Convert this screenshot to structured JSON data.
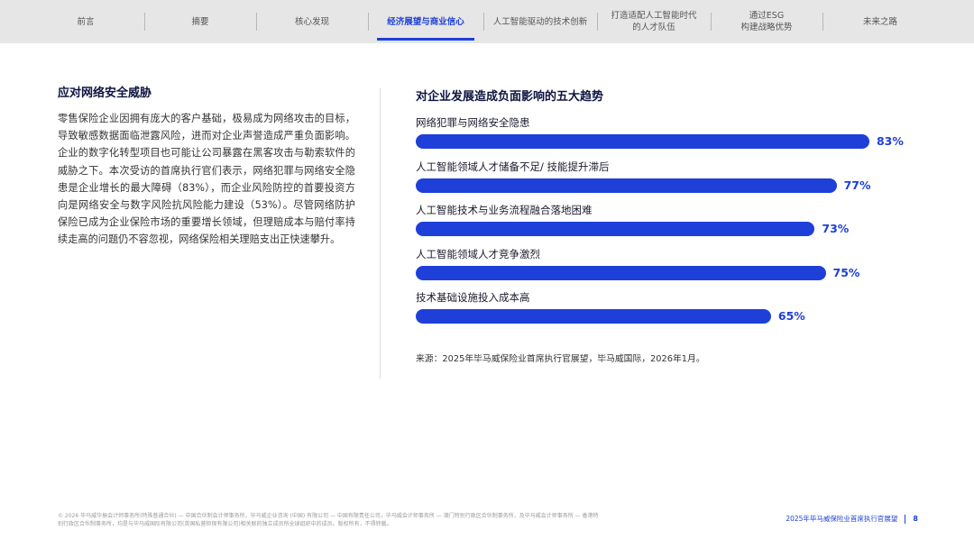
{
  "nav": {
    "items": [
      {
        "label": "前言"
      },
      {
        "label": "摘要"
      },
      {
        "label": "核心发现"
      },
      {
        "label": "经济展望与商业信心",
        "active": true
      },
      {
        "label": "人工智能驱动的技术创新"
      },
      {
        "label": "打造适配人工智能时代\n的人才队伍"
      },
      {
        "label": "通过ESG\n构建战略优势"
      },
      {
        "label": "未来之路"
      }
    ]
  },
  "left": {
    "title": "应对网络安全威胁",
    "body": "零售保险企业因拥有庞大的客户基础，极易成为网络攻击的目标，导致敏感数据面临泄露风险，进而对企业声誉造成严重负面影响。企业的数字化转型项目也可能让公司暴露在黑客攻击与勒索软件的威胁之下。本次受访的首席执行官们表示，网络犯罪与网络安全隐患是企业增长的最大障碍（83%），而企业风险防控的首要投资方向是网络安全与数字风险抗风险能力建设（53%）。尽管网络防护保险已成为企业保险市场的重要增长领域，但理赔成本与赔付率持续走高的问题仍不容忽视，网络保险相关理赔支出正快速攀升。"
  },
  "chart_data": {
    "type": "bar",
    "orientation": "horizontal",
    "title": "对企业发展造成负面影响的五大趋势",
    "categories": [
      "网络犯罪与网络安全隐患",
      "人工智能领域人才储备不足/ 技能提升滞后",
      "人工智能技术与业务流程融合落地困难",
      "人工智能领域人才竞争激烈",
      "技术基础设施投入成本高"
    ],
    "values": [
      83,
      77,
      73,
      75,
      65
    ],
    "value_labels": [
      "83%",
      "77%",
      "73%",
      "75%",
      "65%"
    ],
    "unit": "%",
    "xlim": [
      0,
      100
    ],
    "grid": false,
    "bar_color": "#1e3fd8"
  },
  "source": "来源：2025年毕马威保险业首席执行官展望，毕马威国际，2026年1月。",
  "footer": {
    "note": "© 2026 毕马威华振会计师事务所(特殊普通合伙) — 中国合伙制会计师事务所，毕马威企业咨询 (中国) 有限公司 — 中国有限责任公司，毕马威会计师事务所 — 澳门特别行政区合伙制事务所，及毕马威会计师事务所 — 香港特别行政区合伙制事务所，均是与毕马威国际有限公司(英国私营担保有限公司)相关联的独立成员所全球组织中的成员。版权所有，不得转载。",
    "report": "2025年毕马威保险业首席执行官展望",
    "page": "8"
  },
  "colors": {
    "accent": "#1e3fd8",
    "nav_bg": "#e6e6e6",
    "heading": "#0d1440"
  }
}
